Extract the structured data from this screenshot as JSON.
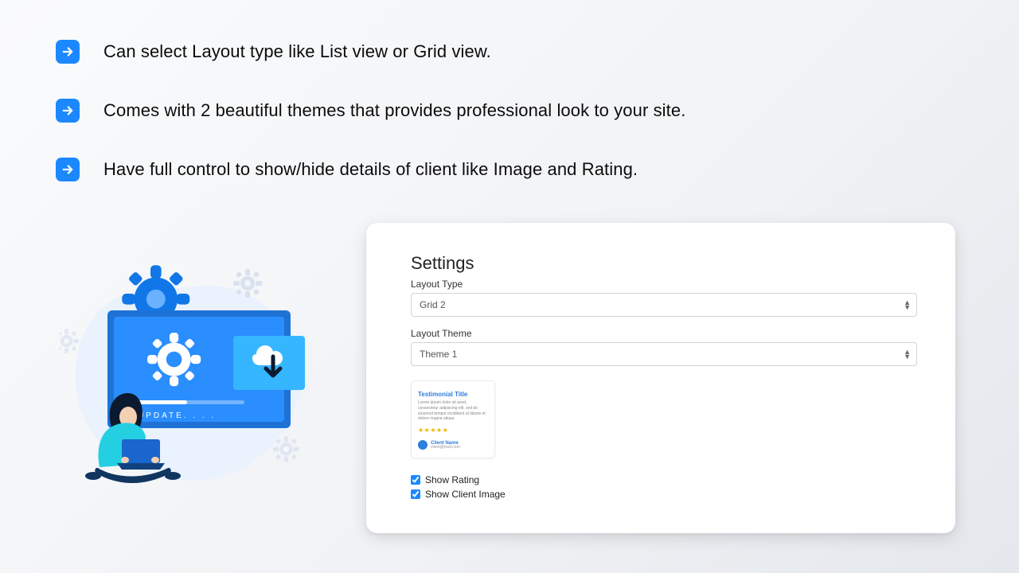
{
  "bullets": [
    "Can select Layout type like List view or Grid view.",
    "Comes with 2 beautiful themes that provides professional look to your site.",
    "Have full control to show/hide details of client like Image and Rating."
  ],
  "illustration": {
    "update_label": "UPDATE. . . ."
  },
  "settings": {
    "heading": "Settings",
    "fields": {
      "layout_type": {
        "label": "Layout Type",
        "value": "Grid 2"
      },
      "layout_theme": {
        "label": "Layout Theme",
        "value": "Theme 1"
      }
    },
    "preview": {
      "title": "Testimonial Title",
      "body": "Lorem ipsum dolor sit amet, consectetur adipiscing elit, sed do eiusmod tempor incididunt ut labore et dolore magna aliqua.",
      "stars": "★★★★★",
      "client_name": "Client Name",
      "client_email": "client@mail.com"
    },
    "checks": {
      "show_rating": {
        "label": "Show Rating",
        "checked": true
      },
      "show_client_image": {
        "label": "Show Client Image",
        "checked": true
      }
    }
  },
  "colors": {
    "accent": "#1c88ff"
  }
}
